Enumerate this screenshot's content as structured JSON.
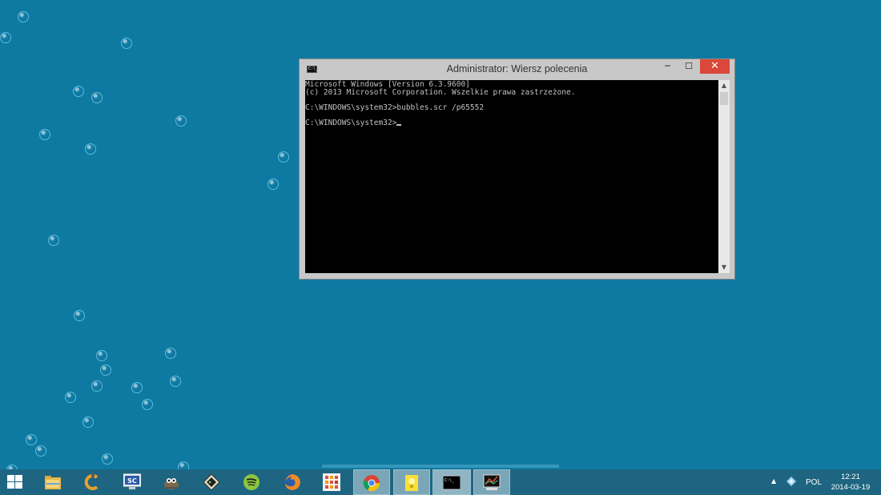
{
  "window": {
    "title": "Administrator: Wiersz polecenia",
    "icon": "cmd-icon",
    "icon_text": "C:\\_",
    "min_symbol": "─",
    "max_symbol": "☐",
    "close_symbol": "✕"
  },
  "console": {
    "lines": [
      "Microsoft Windows [Version 6.3.9600]",
      "(c) 2013 Microsoft Corporation. Wszelkie prawa zastrzeżone.",
      "",
      "C:\\WINDOWS\\system32>bubbles.scr /p65552",
      "",
      "C:\\WINDOWS\\system32>"
    ]
  },
  "scrollbar": {
    "up": "▲",
    "down": "▼"
  },
  "taskbar": {
    "items": [
      {
        "name": "start-button",
        "icon": "windows-logo-icon"
      },
      {
        "name": "file-explorer",
        "icon": "folder-icon"
      },
      {
        "name": "ccleaner",
        "icon": "ccleaner-icon"
      },
      {
        "name": "sc-app",
        "icon": "sc-monitor-icon",
        "label": "SC"
      },
      {
        "name": "gimp",
        "icon": "gimp-icon"
      },
      {
        "name": "terminal-app",
        "icon": "terminal-diamond-icon"
      },
      {
        "name": "spotify",
        "icon": "spotify-icon"
      },
      {
        "name": "firefox",
        "icon": "firefox-icon"
      },
      {
        "name": "apps-grid",
        "icon": "apps-grid-icon"
      },
      {
        "name": "chrome",
        "icon": "chrome-icon"
      },
      {
        "name": "sticky-notes",
        "icon": "lightbulb-icon"
      },
      {
        "name": "command-prompt",
        "icon": "cmd-icon"
      },
      {
        "name": "task-manager",
        "icon": "monitor-graph-icon"
      }
    ],
    "tray": {
      "chevron": "▲",
      "language": "POL",
      "time": "12:21",
      "date": "2014-03-19"
    }
  },
  "colors": {
    "desktop": "#0f7aa1",
    "taskbar": "#1d6580",
    "close_button": "#d9483a"
  }
}
